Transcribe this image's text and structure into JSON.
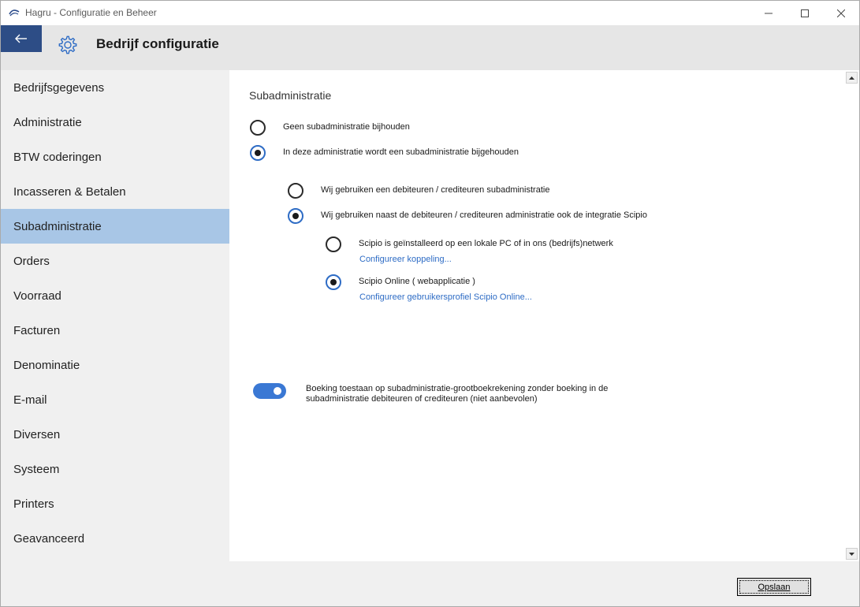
{
  "window": {
    "title": "Hagru - Configuratie en Beheer"
  },
  "header": {
    "title": "Bedrijf configuratie"
  },
  "sidebar": {
    "items": [
      {
        "label": "Bedrijfsgegevens"
      },
      {
        "label": "Administratie"
      },
      {
        "label": "BTW coderingen"
      },
      {
        "label": "Incasseren & Betalen"
      },
      {
        "label": "Subadministratie",
        "active": true
      },
      {
        "label": "Orders"
      },
      {
        "label": "Voorraad"
      },
      {
        "label": "Facturen"
      },
      {
        "label": "Denominatie"
      },
      {
        "label": "E-mail"
      },
      {
        "label": "Diversen"
      },
      {
        "label": "Systeem"
      },
      {
        "label": "Printers"
      },
      {
        "label": "Geavanceerd"
      }
    ]
  },
  "content": {
    "section_title": "Subadministratie",
    "option_none": {
      "label": "Geen subadministratie bijhouden",
      "checked": false
    },
    "option_keep": {
      "label": "In deze administratie wordt een subadministratie bijgehouden",
      "checked": true
    },
    "option_debcred": {
      "label": "Wij gebruiken een debiteuren / crediteuren subadministratie",
      "checked": false
    },
    "option_scipio": {
      "label": "Wij gebruiken naast de debiteuren / crediteuren administratie ook de integratie Scipio",
      "checked": true
    },
    "option_local": {
      "label": "Scipio is geïnstalleerd op een lokale PC of in ons (bedrijfs)netwerk",
      "checked": false,
      "link": "Configureer koppeling..."
    },
    "option_online": {
      "label": "Scipio Online ( webapplicatie )",
      "checked": true,
      "link": "Configureer gebruikersprofiel Scipio Online..."
    },
    "toggle": {
      "on": true,
      "label": "Boeking toestaan op subadministratie-grootboekrekening zonder boeking in de subadministratie debiteuren of crediteuren (niet aanbevolen)"
    }
  },
  "footer": {
    "save_label": "Opslaan"
  },
  "colors": {
    "accent": "#2e6cc5",
    "back_button": "#2d4d86",
    "active_nav": "#a8c6e6"
  },
  "icons": {
    "app": "hagru-logo-icon",
    "back": "arrow-left-icon",
    "settings": "gear-icon"
  }
}
